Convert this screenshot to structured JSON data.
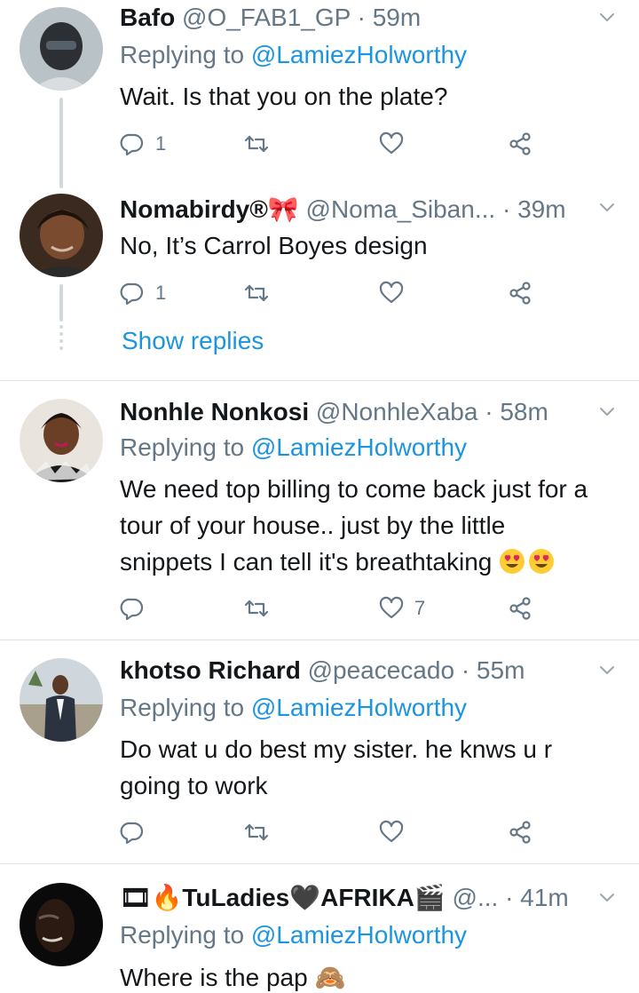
{
  "tweets": [
    {
      "name": "Bafo",
      "handle": "@O_FAB1_GP",
      "time": "59m",
      "replying_label": "Replying to",
      "replying_to": "@LamiezHolworthy",
      "text": "Wait. Is that you on the plate?",
      "replies": "1",
      "retweets": "",
      "likes": ""
    },
    {
      "name": "Nomabirdy®🎀",
      "handle": "@Noma_Siban...",
      "time": "39m",
      "text": "No, It’s Carrol Boyes design",
      "replies": "1",
      "retweets": "",
      "likes": "",
      "show_replies": "Show replies"
    },
    {
      "name": "Nonhle Nonkosi",
      "handle": "@NonhleXaba",
      "time": "58m",
      "replying_label": "Replying to",
      "replying_to": "@LamiezHolworthy",
      "text_lines": [
        "We need top billing to come back just for a",
        "tour of your house.. just by the little",
        "snippets I can tell it's breathtaking"
      ],
      "emoji": [
        "heart-eyes-emoji",
        "heart-eyes-emoji"
      ],
      "replies": "",
      "retweets": "",
      "likes": "7"
    },
    {
      "name": "khotso Richard",
      "handle": "@peacecado",
      "time": "55m",
      "replying_label": "Replying to",
      "replying_to": "@LamiezHolworthy",
      "text_lines": [
        "Do wat u do best my sister. he knws u r",
        "going to work"
      ],
      "replies": "",
      "retweets": "",
      "likes": ""
    },
    {
      "name": "🎞🔥TuLadies🖤AFRIKA🎬",
      "handle": "@...",
      "time": "41m",
      "replying_label": "Replying to",
      "replying_to": "@LamiezHolworthy",
      "text": "Where is the pap 🙈",
      "replies": "",
      "retweets": "",
      "likes": ""
    }
  ],
  "separator": "·",
  "icons": {
    "reply": "reply-icon",
    "retweet": "retweet-icon",
    "like": "heart-icon",
    "share": "share-icon",
    "menu": "chevron-down-icon"
  },
  "colors": {
    "text": "#14171a",
    "secondary": "#657786",
    "link": "#1b95e0",
    "divider": "#dbe3e8",
    "thread_line": "#cfd9de"
  }
}
